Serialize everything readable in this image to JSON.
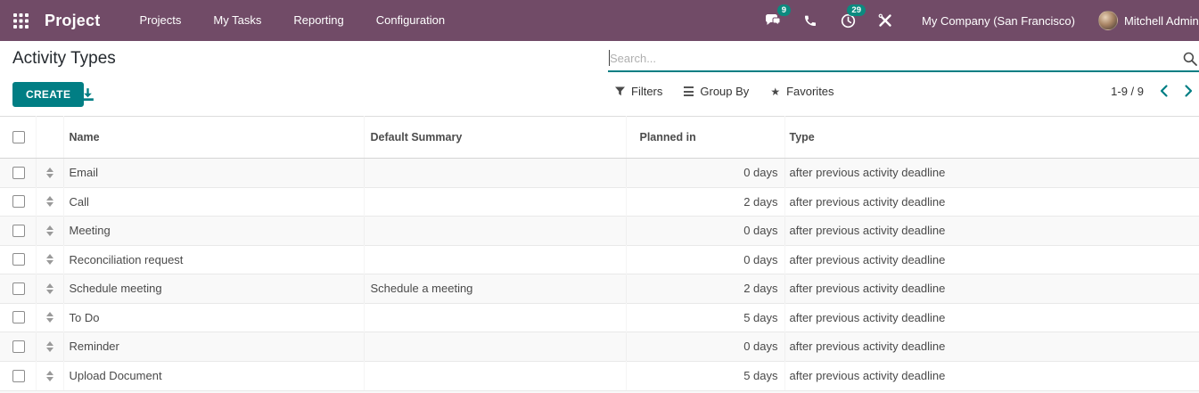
{
  "navbar": {
    "brand": "Project",
    "menu_items": [
      "Projects",
      "My Tasks",
      "Reporting",
      "Configuration"
    ],
    "messages_badge": "9",
    "activities_badge": "29",
    "company": "My Company (San Francisco)",
    "user": "Mitchell Admin"
  },
  "control_panel": {
    "title": "Activity Types",
    "create_label": "CREATE",
    "search_placeholder": "Search...",
    "filters_label": "Filters",
    "group_by_label": "Group By",
    "favorites_label": "Favorites",
    "pager": "1-9 / 9"
  },
  "icons": {
    "apps": "apps-grid",
    "messages": "chat-bubbles",
    "calls": "phone",
    "activities": "clock",
    "tools": "crossed-tools",
    "search": "magnifier",
    "filters": "funnel",
    "group_by": "list-lines",
    "favorites_glyph": "★",
    "prev": "chevron-left",
    "next": "chevron-right",
    "export": "download-tray",
    "row_handle": "drag-arrows"
  },
  "colors": {
    "navbar_bg": "#714B67",
    "accent_teal": "#017e84",
    "badge_teal": "#0c8a7f",
    "zebra_row": "#f9f9f9"
  },
  "table": {
    "columns": [
      "Name",
      "Default Summary",
      "Planned in",
      "Type"
    ],
    "rows": [
      {
        "name": "Email",
        "summary": "",
        "planned": "0 days",
        "type": "after previous activity deadline"
      },
      {
        "name": "Call",
        "summary": "",
        "planned": "2 days",
        "type": "after previous activity deadline"
      },
      {
        "name": "Meeting",
        "summary": "",
        "planned": "0 days",
        "type": "after previous activity deadline"
      },
      {
        "name": "Reconciliation request",
        "summary": "",
        "planned": "0 days",
        "type": "after previous activity deadline"
      },
      {
        "name": "Schedule meeting",
        "summary": "Schedule a meeting",
        "planned": "2 days",
        "type": "after previous activity deadline"
      },
      {
        "name": "To Do",
        "summary": "",
        "planned": "5 days",
        "type": "after previous activity deadline"
      },
      {
        "name": "Reminder",
        "summary": "",
        "planned": "0 days",
        "type": "after previous activity deadline"
      },
      {
        "name": "Upload Document",
        "summary": "",
        "planned": "5 days",
        "type": "after previous activity deadline"
      }
    ]
  }
}
